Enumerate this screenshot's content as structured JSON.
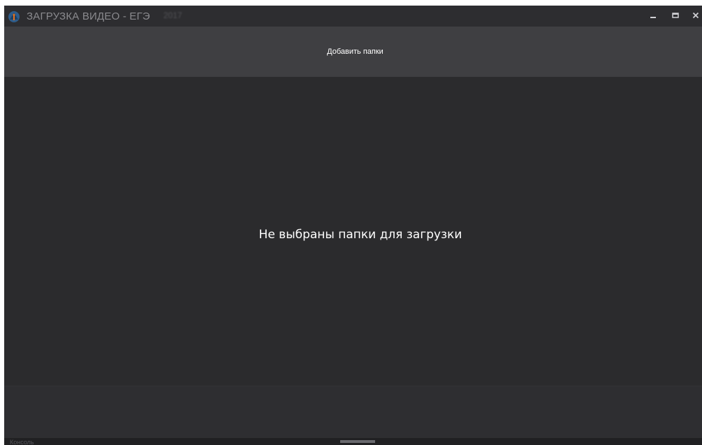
{
  "window": {
    "title": "ЗАГРУЗКА ВИДЕО - ЕГЭ",
    "title_obscured": "2017"
  },
  "controls": {
    "minimize": "minimize-icon",
    "maximize": "maximize-icon",
    "close": "close-icon"
  },
  "toolbar": {
    "add_folders_label": "Добавить папки"
  },
  "main": {
    "empty_message": "Не выбраны папки для загрузки"
  },
  "status": {
    "label": "Консоль"
  },
  "colors": {
    "background": "#2b2b2d",
    "toolbar": "#3f3f42",
    "accent_blue": "#2e5c8a",
    "accent_orange": "#e8731c"
  }
}
